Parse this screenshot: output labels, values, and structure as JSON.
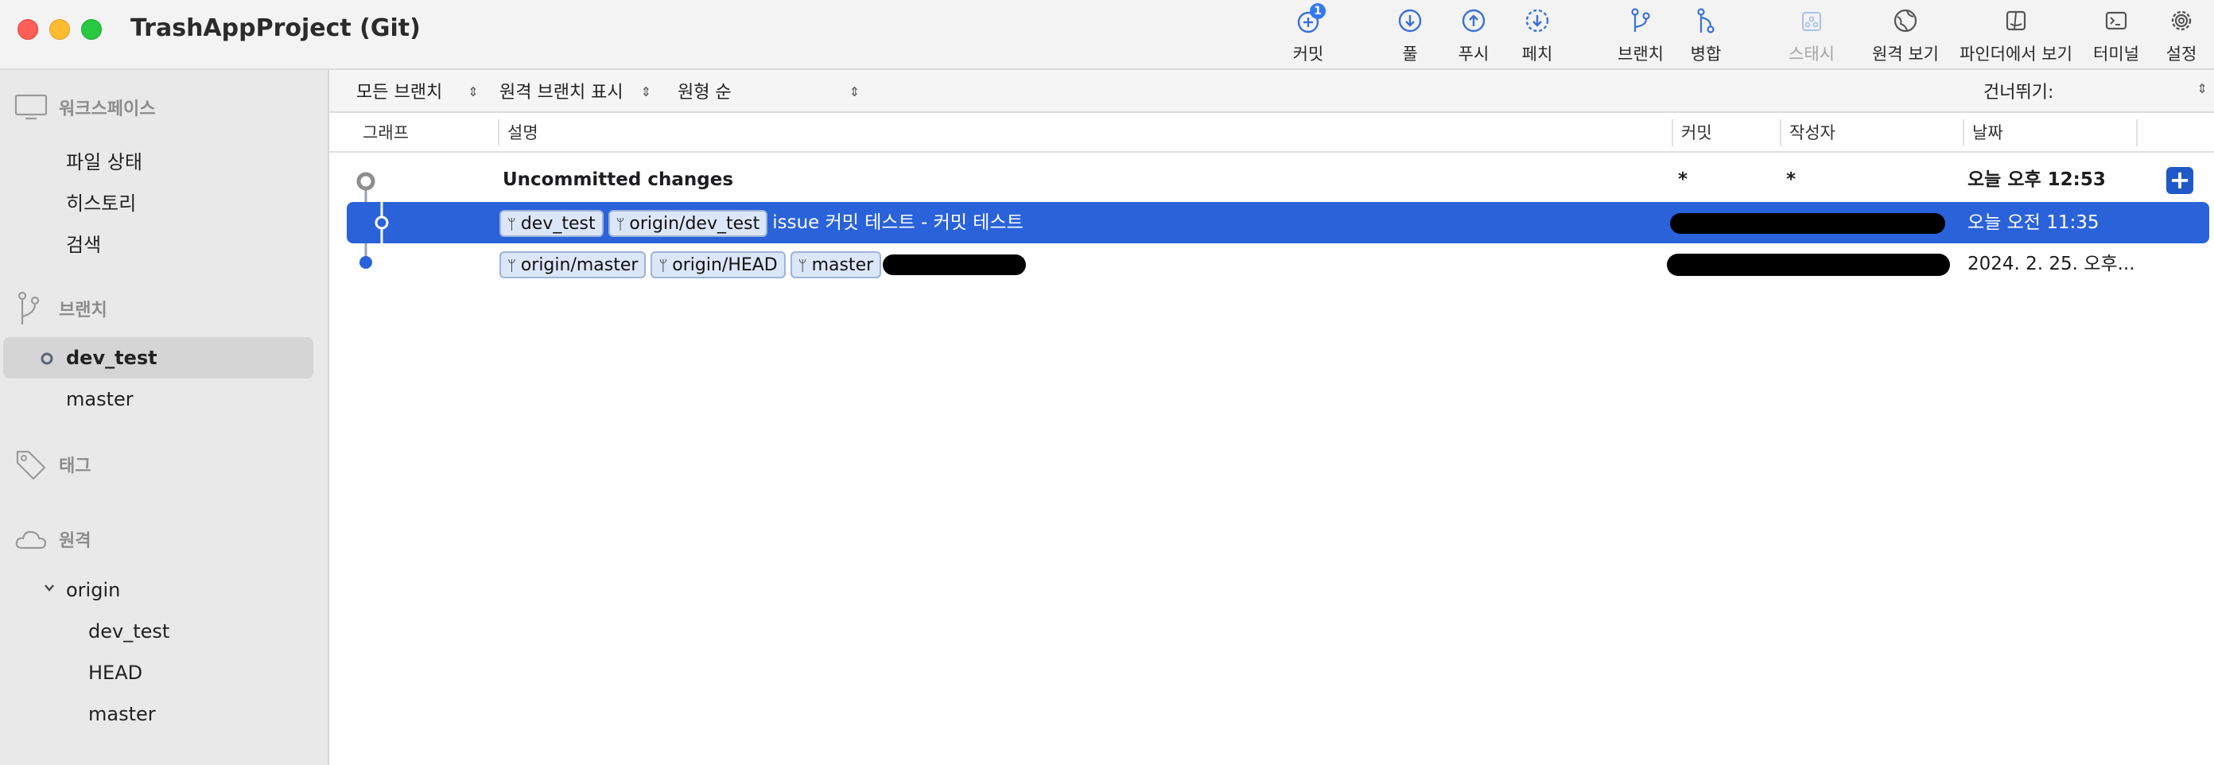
{
  "window": {
    "title": "TrashAppProject (Git)"
  },
  "toolbar": {
    "commit": {
      "label": "커밋",
      "badge": "1"
    },
    "pull": {
      "label": "풀"
    },
    "push": {
      "label": "푸시"
    },
    "fetch": {
      "label": "페치"
    },
    "branch": {
      "label": "브랜치"
    },
    "merge": {
      "label": "병합"
    },
    "stash": {
      "label": "스태시"
    },
    "remote": {
      "label": "원격 보기"
    },
    "finder": {
      "label": "파인더에서 보기"
    },
    "terminal": {
      "label": "터미널"
    },
    "settings": {
      "label": "설정"
    }
  },
  "sidebar": {
    "workspace": {
      "title": "워크스페이스",
      "items": [
        "파일 상태",
        "히스토리",
        "검색"
      ]
    },
    "branches": {
      "title": "브랜치",
      "items": [
        "dev_test",
        "master"
      ],
      "current": "dev_test"
    },
    "tags": {
      "title": "태그"
    },
    "remotes": {
      "title": "원격",
      "origin": "origin",
      "items": [
        "dev_test",
        "HEAD",
        "master"
      ]
    }
  },
  "filters": {
    "branches": "모든 브랜치",
    "remote_branches": "원격 브랜치 표시",
    "order": "원형 순",
    "jump": "건너뛰기:"
  },
  "columns": {
    "graph": "그래프",
    "description": "설명",
    "commit": "커밋",
    "author": "작성자",
    "date": "날짜"
  },
  "rows": [
    {
      "description": "Uncommitted changes",
      "commit": "*",
      "author": "*",
      "date": "오늘 오후 12:53"
    },
    {
      "tags": [
        "dev_test",
        "origin/dev_test"
      ],
      "description": "issue 커밋 테스트 - 커밋 테스트",
      "date": "오늘 오전 11:35",
      "selected": true
    },
    {
      "tags": [
        "origin/master",
        "origin/HEAD",
        "master"
      ],
      "date": "2024. 2. 25. 오후..."
    }
  ],
  "colors": {
    "selection": "#2a62d9",
    "tag_bg": "#dbe6f8",
    "graph_node": "#2a62d9"
  }
}
